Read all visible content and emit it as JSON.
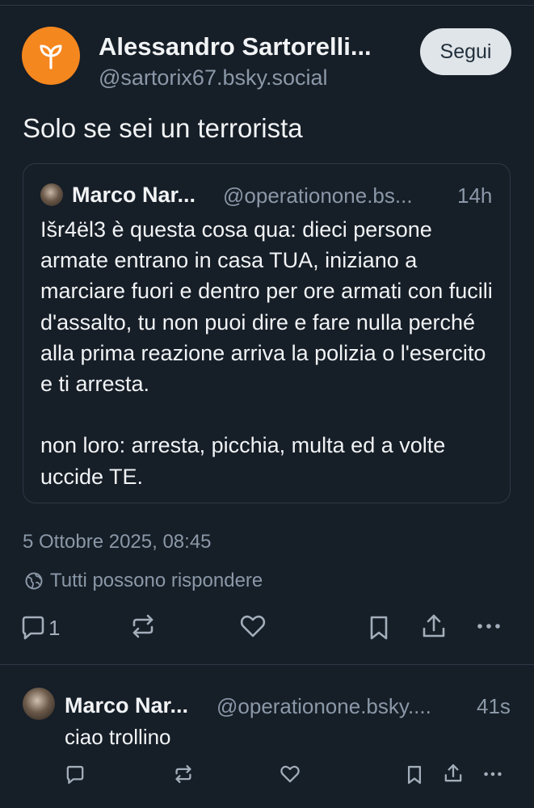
{
  "post": {
    "author_name": "Alessandro Sartorelli...",
    "author_handle": "@sartorix67.bsky.social",
    "follow_label": "Segui",
    "text": "Solo se sei un terrorista",
    "date": "5 Ottobre 2025, 08:45",
    "reply_setting": "Tutti possono rispondere",
    "reply_count": "1",
    "avatar_color": "#f5871f"
  },
  "quote": {
    "author_name": "Marco Nar...",
    "author_handle": "@operationone.bs...",
    "time": "14h",
    "paragraphs": [
      "Išr4ël3 è questa cosa qua: dieci persone armate entrano in casa TUA, iniziano a marciare fuori e dentro per ore armati con fucili d'assalto, tu non puoi dire e fare nulla perché alla prima reazione arriva la polizia o l'esercito e ti arresta.",
      "non loro: arresta, picchia, multa ed a volte uccide TE."
    ]
  },
  "reply": {
    "author_name": "Marco Nar...",
    "author_handle": "@operationone.bsky....",
    "time": "41s",
    "text": "ciao trollino"
  },
  "icons": {
    "post_avatar": "sprout-icon",
    "reply_setting": "globe-icon",
    "actions": [
      "reply-icon",
      "repost-icon",
      "like-icon",
      "bookmark-icon",
      "share-icon",
      "more-icon"
    ]
  },
  "colors": {
    "background": "#161e27",
    "text": "#f1f3f5",
    "muted": "#8b98a8",
    "border": "#2c3947",
    "follow_button_bg": "#e0e5ea"
  }
}
